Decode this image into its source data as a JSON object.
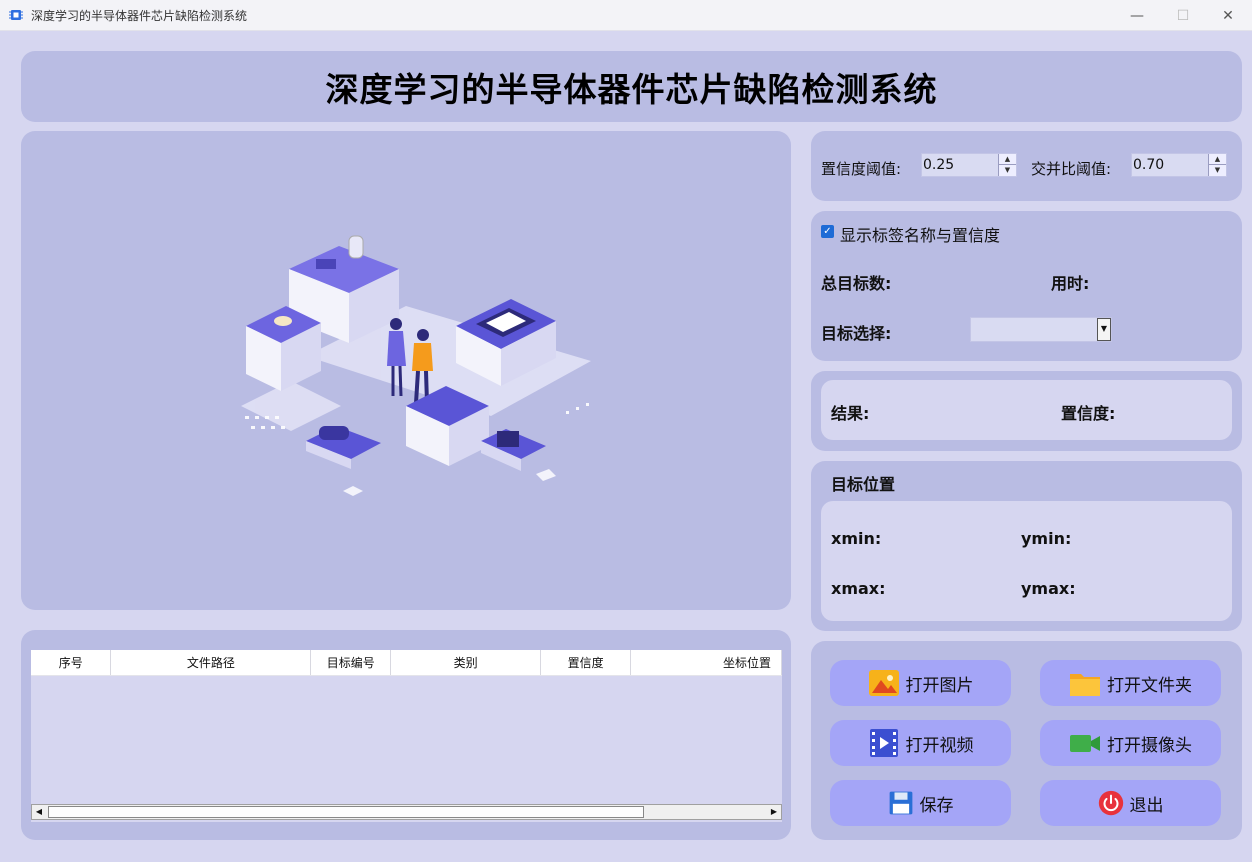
{
  "window": {
    "title": "深度学习的半导体器件芯片缺陷检测系统",
    "minimize": "—",
    "maximize": "☐",
    "close": "✕"
  },
  "header": {
    "title": "深度学习的半导体器件芯片缺陷检测系统"
  },
  "params": {
    "conf_label": "置信度阈值:",
    "conf_value": "0.25",
    "iou_label": "交并比阈值:",
    "iou_value": "0.70"
  },
  "stats": {
    "show_labels": "显示标签名称与置信度",
    "total_targets": "总目标数:",
    "time_used": "用时:",
    "target_select": "目标选择:"
  },
  "result": {
    "result_label": "结果:",
    "confidence_label": "置信度:"
  },
  "position": {
    "title": "目标位置",
    "xmin": "xmin:",
    "ymin": "ymin:",
    "xmax": "xmax:",
    "ymax": "ymax:"
  },
  "table": {
    "columns": [
      "序号",
      "文件路径",
      "目标编号",
      "类别",
      "置信度",
      "坐标位置"
    ]
  },
  "buttons": {
    "open_image": "打开图片",
    "open_folder": "打开文件夹",
    "open_video": "打开视频",
    "open_camera": "打开摄像头",
    "save": "保存",
    "exit": "退出"
  },
  "colors": {
    "accent": "#a4a5f7",
    "panel": "#b9bce3",
    "background": "#d6d6f0",
    "illustration_purple": "#5a55d6"
  }
}
